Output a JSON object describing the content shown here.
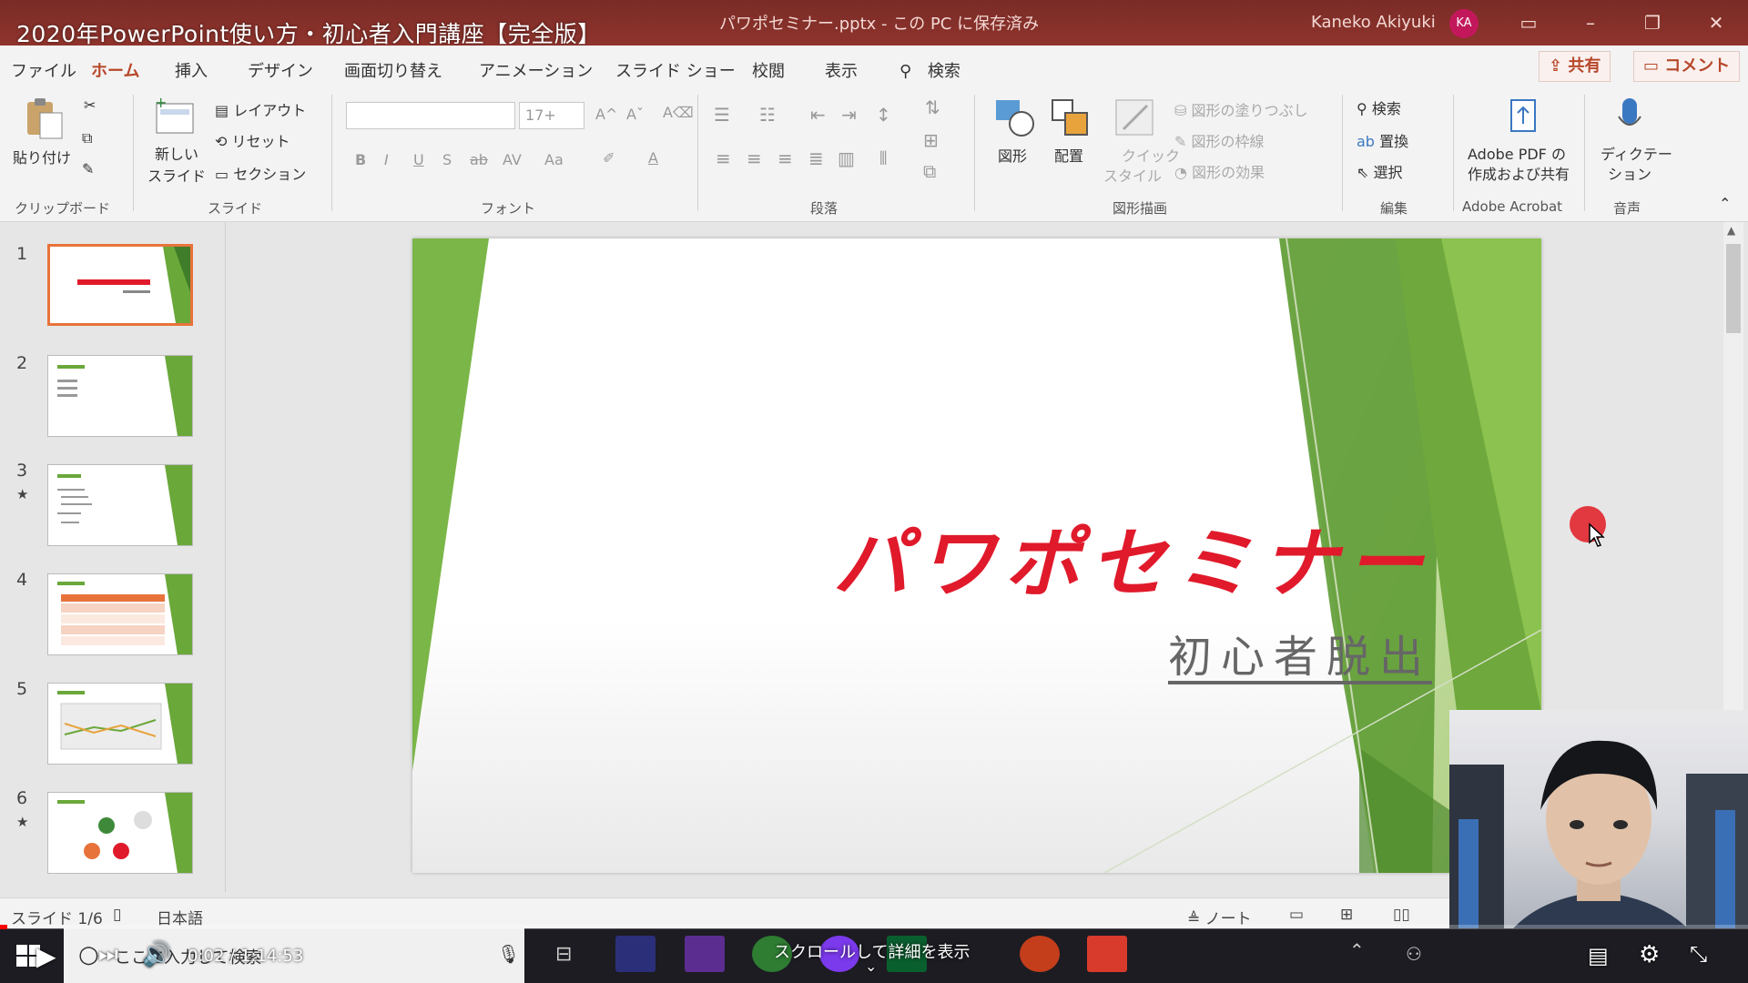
{
  "video": {
    "title": "2020年PowerPoint使い方・初心者入門講座【完全版】",
    "time_current": "0:02",
    "time_total": "1:14:53",
    "time_separator": " / ",
    "progress": 0.0004,
    "scroll_hint": "スクロールして詳細を表示"
  },
  "window": {
    "document_title": "パワポセミナー.pptx - この PC に保存済み",
    "user_name": "Kaneko Akiyuki",
    "avatar_initials": "KA"
  },
  "menu": {
    "tabs": [
      "ファイル",
      "ホーム",
      "挿入",
      "デザイン",
      "画面切り替え",
      "アニメーション",
      "スライド ショー",
      "校閲",
      "表示",
      "検索"
    ],
    "active_tab": "ホーム",
    "share_label": "共有",
    "comment_label": "コメント"
  },
  "ribbon": {
    "clipboard": {
      "paste_label": "貼り付け",
      "group_label": "クリップボード"
    },
    "slides": {
      "new_slide_label_1": "新しい",
      "new_slide_label_2": "スライド",
      "layout_label": "レイアウト",
      "reset_label": "リセット",
      "section_label": "セクション",
      "group_label": "スライド"
    },
    "font": {
      "size_value": "17+",
      "bold": "B",
      "italic": "I",
      "underline": "U",
      "shadow": "S",
      "strike": "ab",
      "spacing": "AV",
      "case": "Aa",
      "color": "A",
      "group_label": "フォント"
    },
    "paragraph": {
      "group_label": "段落"
    },
    "drawing": {
      "shapes_label": "図形",
      "arrange_label": "配置",
      "quick_styles_label_1": "クイック",
      "quick_styles_label_2": "スタイル",
      "fill_label": "図形の塗りつぶし",
      "outline_label": "図形の枠線",
      "effects_label": "図形の効果",
      "group_label": "図形描画"
    },
    "editing": {
      "find_label": "検索",
      "replace_label": "置換",
      "select_label": "選択",
      "group_label": "編集"
    },
    "acrobat": {
      "pdf_label_1": "Adobe PDF の",
      "pdf_label_2": "作成および共有",
      "group_label": "Adobe Acrobat"
    },
    "voice": {
      "dictate_label_1": "ディクテー",
      "dictate_label_2": "ション",
      "group_label": "音声"
    }
  },
  "thumbnails": [
    {
      "number": "1",
      "star": ""
    },
    {
      "number": "2",
      "star": ""
    },
    {
      "number": "3",
      "star": "★"
    },
    {
      "number": "4",
      "star": ""
    },
    {
      "number": "5",
      "star": ""
    },
    {
      "number": "6",
      "star": "★"
    }
  ],
  "slide": {
    "title": "パワポセミナー",
    "subtitle": "初心者脱出",
    "title_color": "#e01a2b",
    "accent_green": "#6aa83a"
  },
  "status": {
    "slide_count": "スライド 1/6",
    "language": "日本語",
    "notes_label": "ノート"
  },
  "taskbar": {
    "search_placeholder": "ここに入力して検索"
  },
  "colors": {
    "titlebar": "#8a3129",
    "accent": "#b7472a"
  }
}
